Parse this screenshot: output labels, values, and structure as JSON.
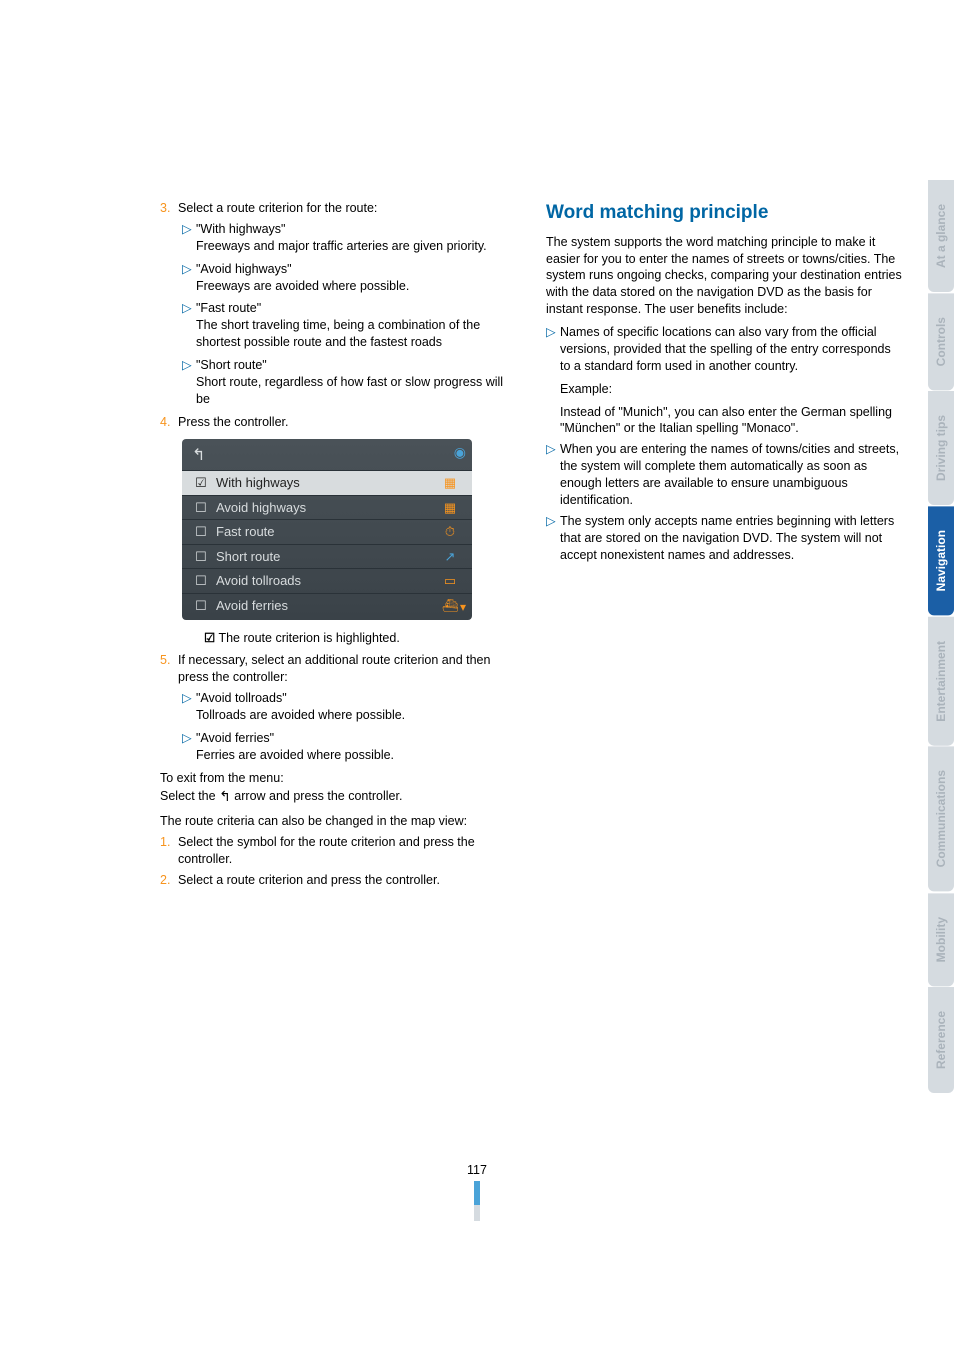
{
  "left": {
    "step3": "Select a route criterion for the route:",
    "s3a_q": "\"With highways\"",
    "s3a_t": "Freeways and major traffic arteries are given priority.",
    "s3b_q": "\"Avoid highways\"",
    "s3b_t": "Freeways are avoided where possible.",
    "s3c_q": "\"Fast route\"",
    "s3c_t": "The short traveling time, being a combination of the shortest possible route and the fastest roads",
    "s3d_q": "\"Short route\"",
    "s3d_t": "Short route, regardless of how fast or slow progress will be",
    "step4": "Press the controller.",
    "screenshot": {
      "r1": "With highways",
      "r2": "Avoid highways",
      "r3": "Fast route",
      "r4": "Short route",
      "r5": "Avoid tollroads",
      "r6": "Avoid ferries"
    },
    "highlight_note": " The route criterion is highlighted.",
    "step5": "If necessary, select an additional route criterion and then press the controller:",
    "s5a_q": "\"Avoid tollroads\"",
    "s5a_t": "Tollroads are avoided where possible.",
    "s5b_q": "\"Avoid ferries\"",
    "s5b_t": "Ferries are avoided where possible.",
    "exit1": "To exit from the menu:",
    "exit2a": "Select the ",
    "exit2b": " arrow and press the controller.",
    "mapview": "The route criteria can also be changed in the map view:",
    "mv1": "Select the symbol for the route criterion and press the controller.",
    "mv2": "Select a route criterion and press the controller."
  },
  "right": {
    "heading": "Word matching principle",
    "intro": "The system supports the word matching principle to make it easier for you to enter the names of streets or towns/cities. The system runs ongoing checks, comparing your destination entries with the data stored on the navigation DVD as the basis for instant response. The user benefits include:",
    "b1a": "Names of specific locations can also vary from the official versions, provided that the spelling of the entry corresponds to a standard form used in another country.",
    "b1_ex_label": "Example:",
    "b1_ex": "Instead of \"Munich\", you can also enter the German spelling \"München\" or the Italian spelling \"Monaco\".",
    "b2": "When you are entering the names of towns/cities and streets, the system will complete them automatically as soon as enough letters are available to ensure unambiguous identification.",
    "b3": "The system only accepts name entries beginning with letters that are stored on the navigation DVD. The system will not accept nonexistent names and addresses."
  },
  "tabs": {
    "t1": "At a glance",
    "t2": "Controls",
    "t3": "Driving tips",
    "t4": "Navigation",
    "t5": "Entertainment",
    "t6": "Communications",
    "t7": "Mobility",
    "t8": "Reference"
  },
  "pagenum": "117"
}
